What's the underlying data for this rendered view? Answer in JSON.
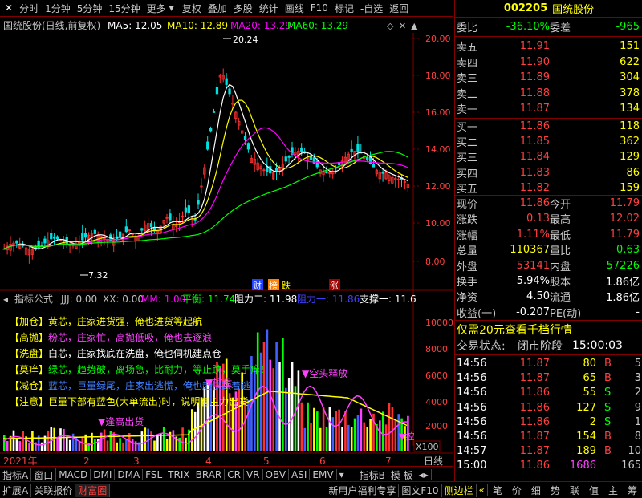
{
  "toolbar": {
    "items": [
      "分时",
      "1分钟",
      "5分钟",
      "15分钟",
      "更多",
      "复权",
      "叠加",
      "多股",
      "统计",
      "画线",
      "F10",
      "标记",
      "-自选",
      "返回"
    ]
  },
  "stock": {
    "code": "002205",
    "name": "国统股份"
  },
  "chart": {
    "title": "国统股份(日线,前复权)",
    "ma": [
      {
        "label": "MA5: 12.05",
        "color": "#ffffff"
      },
      {
        "label": "MA10: 12.89",
        "color": "#ffff00"
      },
      {
        "label": "MA20: 13.29",
        "color": "#ff00ff"
      },
      {
        "label": "MA60: 13.29",
        "color": "#00ff00"
      }
    ],
    "yticks": [
      "20.00",
      "18.00",
      "16.00",
      "14.00",
      "12.00",
      "10.00",
      "8.00"
    ],
    "high_label": "20.24",
    "low_label": "7.32",
    "markers": [
      "财",
      "榜",
      "跌",
      "涨"
    ]
  },
  "indicator": {
    "title": "指标公式",
    "values": [
      {
        "label": "JJJ: 0.00",
        "color": "#c0c0c0"
      },
      {
        "label": "XX: 0.00",
        "color": "#c0c0c0"
      },
      {
        "label": "MM: 1.00",
        "color": "#ff00ff"
      },
      {
        "label": "平衡: 11.74",
        "color": "#00ff00"
      },
      {
        "label": "阻力二: 11.98",
        "color": "#ffffff"
      },
      {
        "label": "阻力一: 11.86",
        "color": "#4040ff"
      },
      {
        "label": "支撑一: 11.6",
        "color": "#ffffff"
      }
    ],
    "yticks": [
      "10000",
      "8000",
      "6000",
      "4000",
      "2000"
    ],
    "x100": "X100",
    "legend": [
      {
        "tag": "【加仓】",
        "head": "黄芯",
        "text": "，庄家进货强，俺也进货等起航",
        "color": "#ffff00"
      },
      {
        "tag": "【高抛】",
        "head": "粉芯",
        "text": "，庄家忙，高抛低吸，俺也去逐浪",
        "color": "#ff40ff"
      },
      {
        "tag": "【洗盘】",
        "head": "白芯",
        "text": "，庄家找底在洗盘，俺也伺机建点仓",
        "color": "#ffffff"
      },
      {
        "tag": "【莫痒】",
        "head": "绿芯",
        "text": "，趋势破，离场急，比耐力，等止跌，莫手痒！",
        "color": "#00ff00"
      },
      {
        "tag": "【减仓】",
        "head": "蓝芯",
        "text": "，巨量绿尾，庄家出逃慌，俺也赶快跟着逃",
        "color": "#4080ff"
      },
      {
        "tag": "【注意】",
        "head": "巨量下部有蓝色",
        "text": "(大单流出)时，说明有主力出货",
        "color": "#ffff00"
      }
    ],
    "annotations": [
      "▼逢高出货",
      "▼空头释放",
      "▼控盘",
      "▼控"
    ]
  },
  "xaxis": {
    "labels": [
      "2021年",
      "2",
      "3",
      "4",
      "5",
      "6",
      "7"
    ],
    "period": "日线"
  },
  "tabs": {
    "items": [
      "指标A",
      "窗口",
      "MACD",
      "DMI",
      "DMA",
      "FSL",
      "TRIX",
      "BRAR",
      "CR",
      "VR",
      "OBV",
      "ASI",
      "EMV"
    ],
    "more": "指标B",
    "template": "模 板"
  },
  "footer": {
    "left": [
      "扩展A",
      "关联报价",
      "财富圈"
    ],
    "mid": [
      "新用户福利专享",
      "图文F10",
      "侧边栏"
    ],
    "right": [
      "笔",
      "价",
      "细",
      "势",
      "联",
      "值",
      "主",
      "筹"
    ]
  },
  "quote": {
    "weibi_label": "委比",
    "weibi": "-36.10%",
    "weicha_label": "委差",
    "weicha": "-965",
    "sell": [
      {
        "label": "卖五",
        "price": "11.91",
        "vol": "151"
      },
      {
        "label": "卖四",
        "price": "11.90",
        "vol": "622"
      },
      {
        "label": "卖三",
        "price": "11.89",
        "vol": "304"
      },
      {
        "label": "卖二",
        "price": "11.88",
        "vol": "378"
      },
      {
        "label": "卖一",
        "price": "11.87",
        "vol": "134"
      }
    ],
    "buy": [
      {
        "label": "买一",
        "price": "11.86",
        "vol": "118"
      },
      {
        "label": "买二",
        "price": "11.85",
        "vol": "362"
      },
      {
        "label": "买三",
        "price": "11.84",
        "vol": "129"
      },
      {
        "label": "买四",
        "price": "11.83",
        "vol": "86"
      },
      {
        "label": "买五",
        "price": "11.82",
        "vol": "159"
      }
    ],
    "stats": [
      {
        "l1": "现价",
        "v1": "11.86",
        "c1": "#ff4040",
        "l2": "今开",
        "v2": "11.79",
        "c2": "#ff4040"
      },
      {
        "l1": "涨跌",
        "v1": "0.13",
        "c1": "#ff4040",
        "l2": "最高",
        "v2": "12.02",
        "c2": "#ff4040"
      },
      {
        "l1": "涨幅",
        "v1": "1.11%",
        "c1": "#ff4040",
        "l2": "最低",
        "v2": "11.79",
        "c2": "#ff4040"
      },
      {
        "l1": "总量",
        "v1": "110367",
        "c1": "#ffff00",
        "l2": "量比",
        "v2": "0.63",
        "c2": "#00ff00"
      },
      {
        "l1": "外盘",
        "v1": "53141",
        "c1": "#ff4040",
        "l2": "内盘",
        "v2": "57226",
        "c2": "#00ff00"
      }
    ],
    "stats2": [
      {
        "l1": "换手",
        "v1": "5.94%",
        "l2": "股本",
        "v2": "1.86亿"
      },
      {
        "l1": "净资",
        "v1": "4.50",
        "l2": "流通",
        "v2": "1.86亿"
      },
      {
        "l1": "收益(一)",
        "v1": "-0.207",
        "l2": "PE(动)",
        "v2": "-"
      }
    ],
    "promo": "仅需20元查看千档行情",
    "status_label": "交易状态:",
    "status": "闭市阶段",
    "status_time": "15:00:03",
    "ticks": [
      {
        "t": "14:56",
        "p": "11.87",
        "v": "80",
        "bs": "B",
        "n": "5"
      },
      {
        "t": "14:56",
        "p": "11.87",
        "v": "65",
        "bs": "B",
        "n": "3"
      },
      {
        "t": "14:56",
        "p": "11.86",
        "v": "55",
        "bs": "S",
        "n": "2"
      },
      {
        "t": "14:56",
        "p": "11.86",
        "v": "127",
        "bs": "S",
        "n": "9"
      },
      {
        "t": "14:56",
        "p": "11.86",
        "v": "2",
        "bs": "S",
        "n": "1"
      },
      {
        "t": "14:56",
        "p": "11.87",
        "v": "154",
        "bs": "B",
        "n": "8"
      },
      {
        "t": "14:57",
        "p": "11.87",
        "v": "189",
        "bs": "B",
        "n": "10"
      },
      {
        "t": "15:00",
        "p": "11.86",
        "v": "1686",
        "bs": "",
        "n": "165"
      }
    ]
  }
}
